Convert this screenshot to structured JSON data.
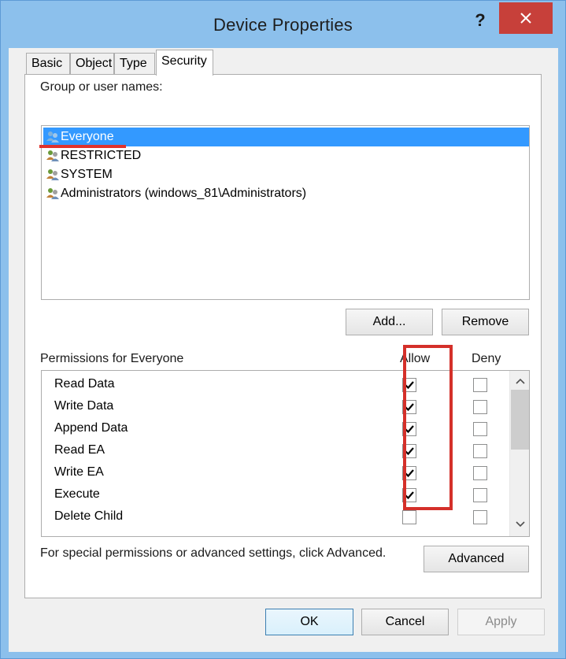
{
  "window": {
    "title": "Device Properties",
    "help_label": "?",
    "close_icon": "close-icon"
  },
  "tabs": [
    {
      "label": "Basic"
    },
    {
      "label": "Object"
    },
    {
      "label": "Type"
    },
    {
      "label": "Security",
      "active": true
    }
  ],
  "security": {
    "group_label": "Group or user names:",
    "users": [
      {
        "name": "Everyone",
        "selected": true
      },
      {
        "name": "RESTRICTED"
      },
      {
        "name": "SYSTEM"
      },
      {
        "name": "Administrators (windows_81\\Administrators)"
      }
    ],
    "add_button": "Add...",
    "remove_button": "Remove",
    "permissions_label": "Permissions for Everyone",
    "allow_header": "Allow",
    "deny_header": "Deny",
    "permissions": [
      {
        "name": "Read Data",
        "allow": true,
        "deny": false
      },
      {
        "name": "Write Data",
        "allow": true,
        "deny": false
      },
      {
        "name": "Append Data",
        "allow": true,
        "deny": false
      },
      {
        "name": "Read EA",
        "allow": true,
        "deny": false
      },
      {
        "name": "Write EA",
        "allow": true,
        "deny": false
      },
      {
        "name": "Execute",
        "allow": true,
        "deny": false
      },
      {
        "name": "Delete Child",
        "allow": false,
        "deny": false
      }
    ],
    "advanced_hint": "For special permissions or advanced settings, click Advanced.",
    "advanced_button": "Advanced"
  },
  "footer": {
    "ok_button": "OK",
    "cancel_button": "Cancel",
    "apply_button": "Apply"
  },
  "colors": {
    "accent_selection": "#3399ff",
    "highlight_annotation": "#d4302a",
    "close_button": "#c7403a",
    "window_frame": "#8cc0ec"
  }
}
